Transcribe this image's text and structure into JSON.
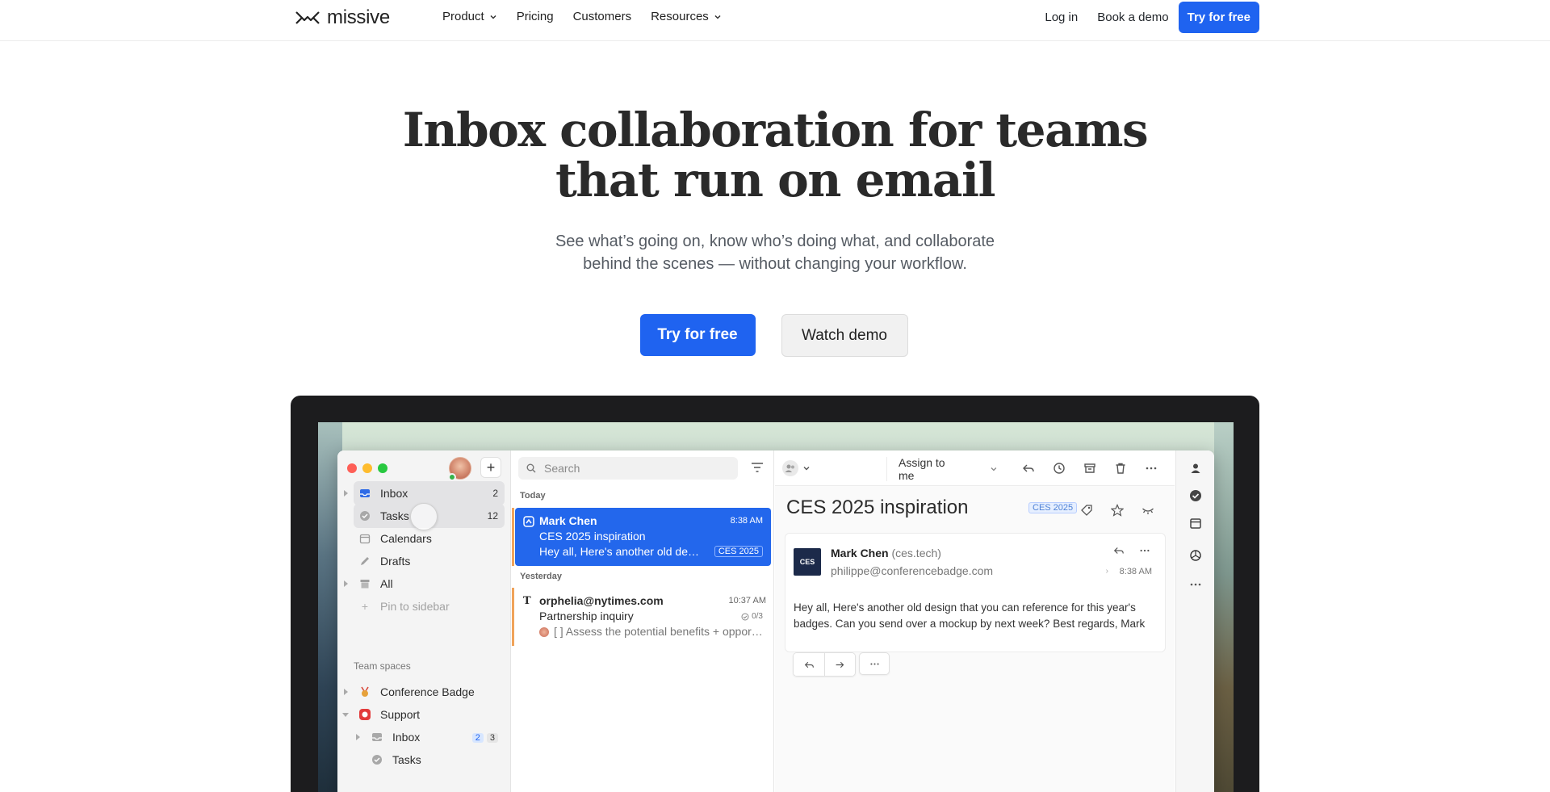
{
  "nav": {
    "brand": "missive",
    "links": [
      {
        "label": "Product",
        "has_menu": true
      },
      {
        "label": "Pricing",
        "has_menu": false
      },
      {
        "label": "Customers",
        "has_menu": false
      },
      {
        "label": "Resources",
        "has_menu": true
      }
    ],
    "login": "Log in",
    "demo": "Book a demo",
    "cta": "Try for free"
  },
  "hero": {
    "title_line1": "Inbox collaboration for teams",
    "title_line2": "that run on email",
    "subtitle_line1": "See what’s going on, know who’s doing what, and collaborate",
    "subtitle_line2": "behind the scenes — without changing your workflow.",
    "primary_cta": "Try for free",
    "secondary_cta": "Watch demo"
  },
  "colors": {
    "accent": "#1f63f0",
    "selected_row": "#2367ec",
    "traffic_red": "#fe5f57",
    "traffic_yellow": "#febc2e",
    "traffic_green": "#28c840"
  },
  "app": {
    "sidebar": {
      "items": [
        {
          "label": "Inbox",
          "count": "2",
          "icon": "inbox-icon"
        },
        {
          "label": "Tasks",
          "count": "12",
          "icon": "check-circle-icon"
        },
        {
          "label": "Calendars",
          "count": "",
          "icon": "calendar-icon"
        },
        {
          "label": "Drafts",
          "count": "",
          "icon": "pencil-icon"
        },
        {
          "label": "All",
          "count": "",
          "icon": "archive-icon"
        },
        {
          "label": "Pin to sidebar",
          "count": "",
          "icon": "plus-icon"
        }
      ],
      "section_label": "Team spaces",
      "teams": [
        {
          "label": "Conference Badge",
          "icon": "medal-icon"
        },
        {
          "label": "Support",
          "icon": "lifebuoy-icon"
        }
      ],
      "support_children": [
        {
          "label": "Inbox",
          "badge_blue": "2",
          "badge_gray": "3"
        },
        {
          "label": "Tasks"
        }
      ]
    },
    "list": {
      "search_placeholder": "Search",
      "today_label": "Today",
      "yesterday_label": "Yesterday",
      "conversations": [
        {
          "from": "Mark Chen",
          "time": "8:38 AM",
          "subject": "CES 2025 inspiration",
          "preview": "Hey all, Here's another old design",
          "tag": "CES 2025"
        },
        {
          "from": "orphelia@nytimes.com",
          "time": "10:37 AM",
          "subject": "Partnership inquiry",
          "preview": "[ ] Assess the potential benefits + opportunities",
          "task_progress": "0/3"
        }
      ]
    },
    "pane": {
      "assign_label": "Assign to me",
      "title": "CES 2025 inspiration",
      "tag": "CES 2025",
      "message": {
        "logo_text": "CES",
        "sender": "Mark Chen",
        "sender_domain": "(ces.tech)",
        "email": "philippe@conferencebadge.com",
        "time": "8:38 AM",
        "body": "Hey all, Here's another old design that you can reference for this year's badges. Can you send over a mockup by next week? Best regards, Mark"
      }
    }
  }
}
